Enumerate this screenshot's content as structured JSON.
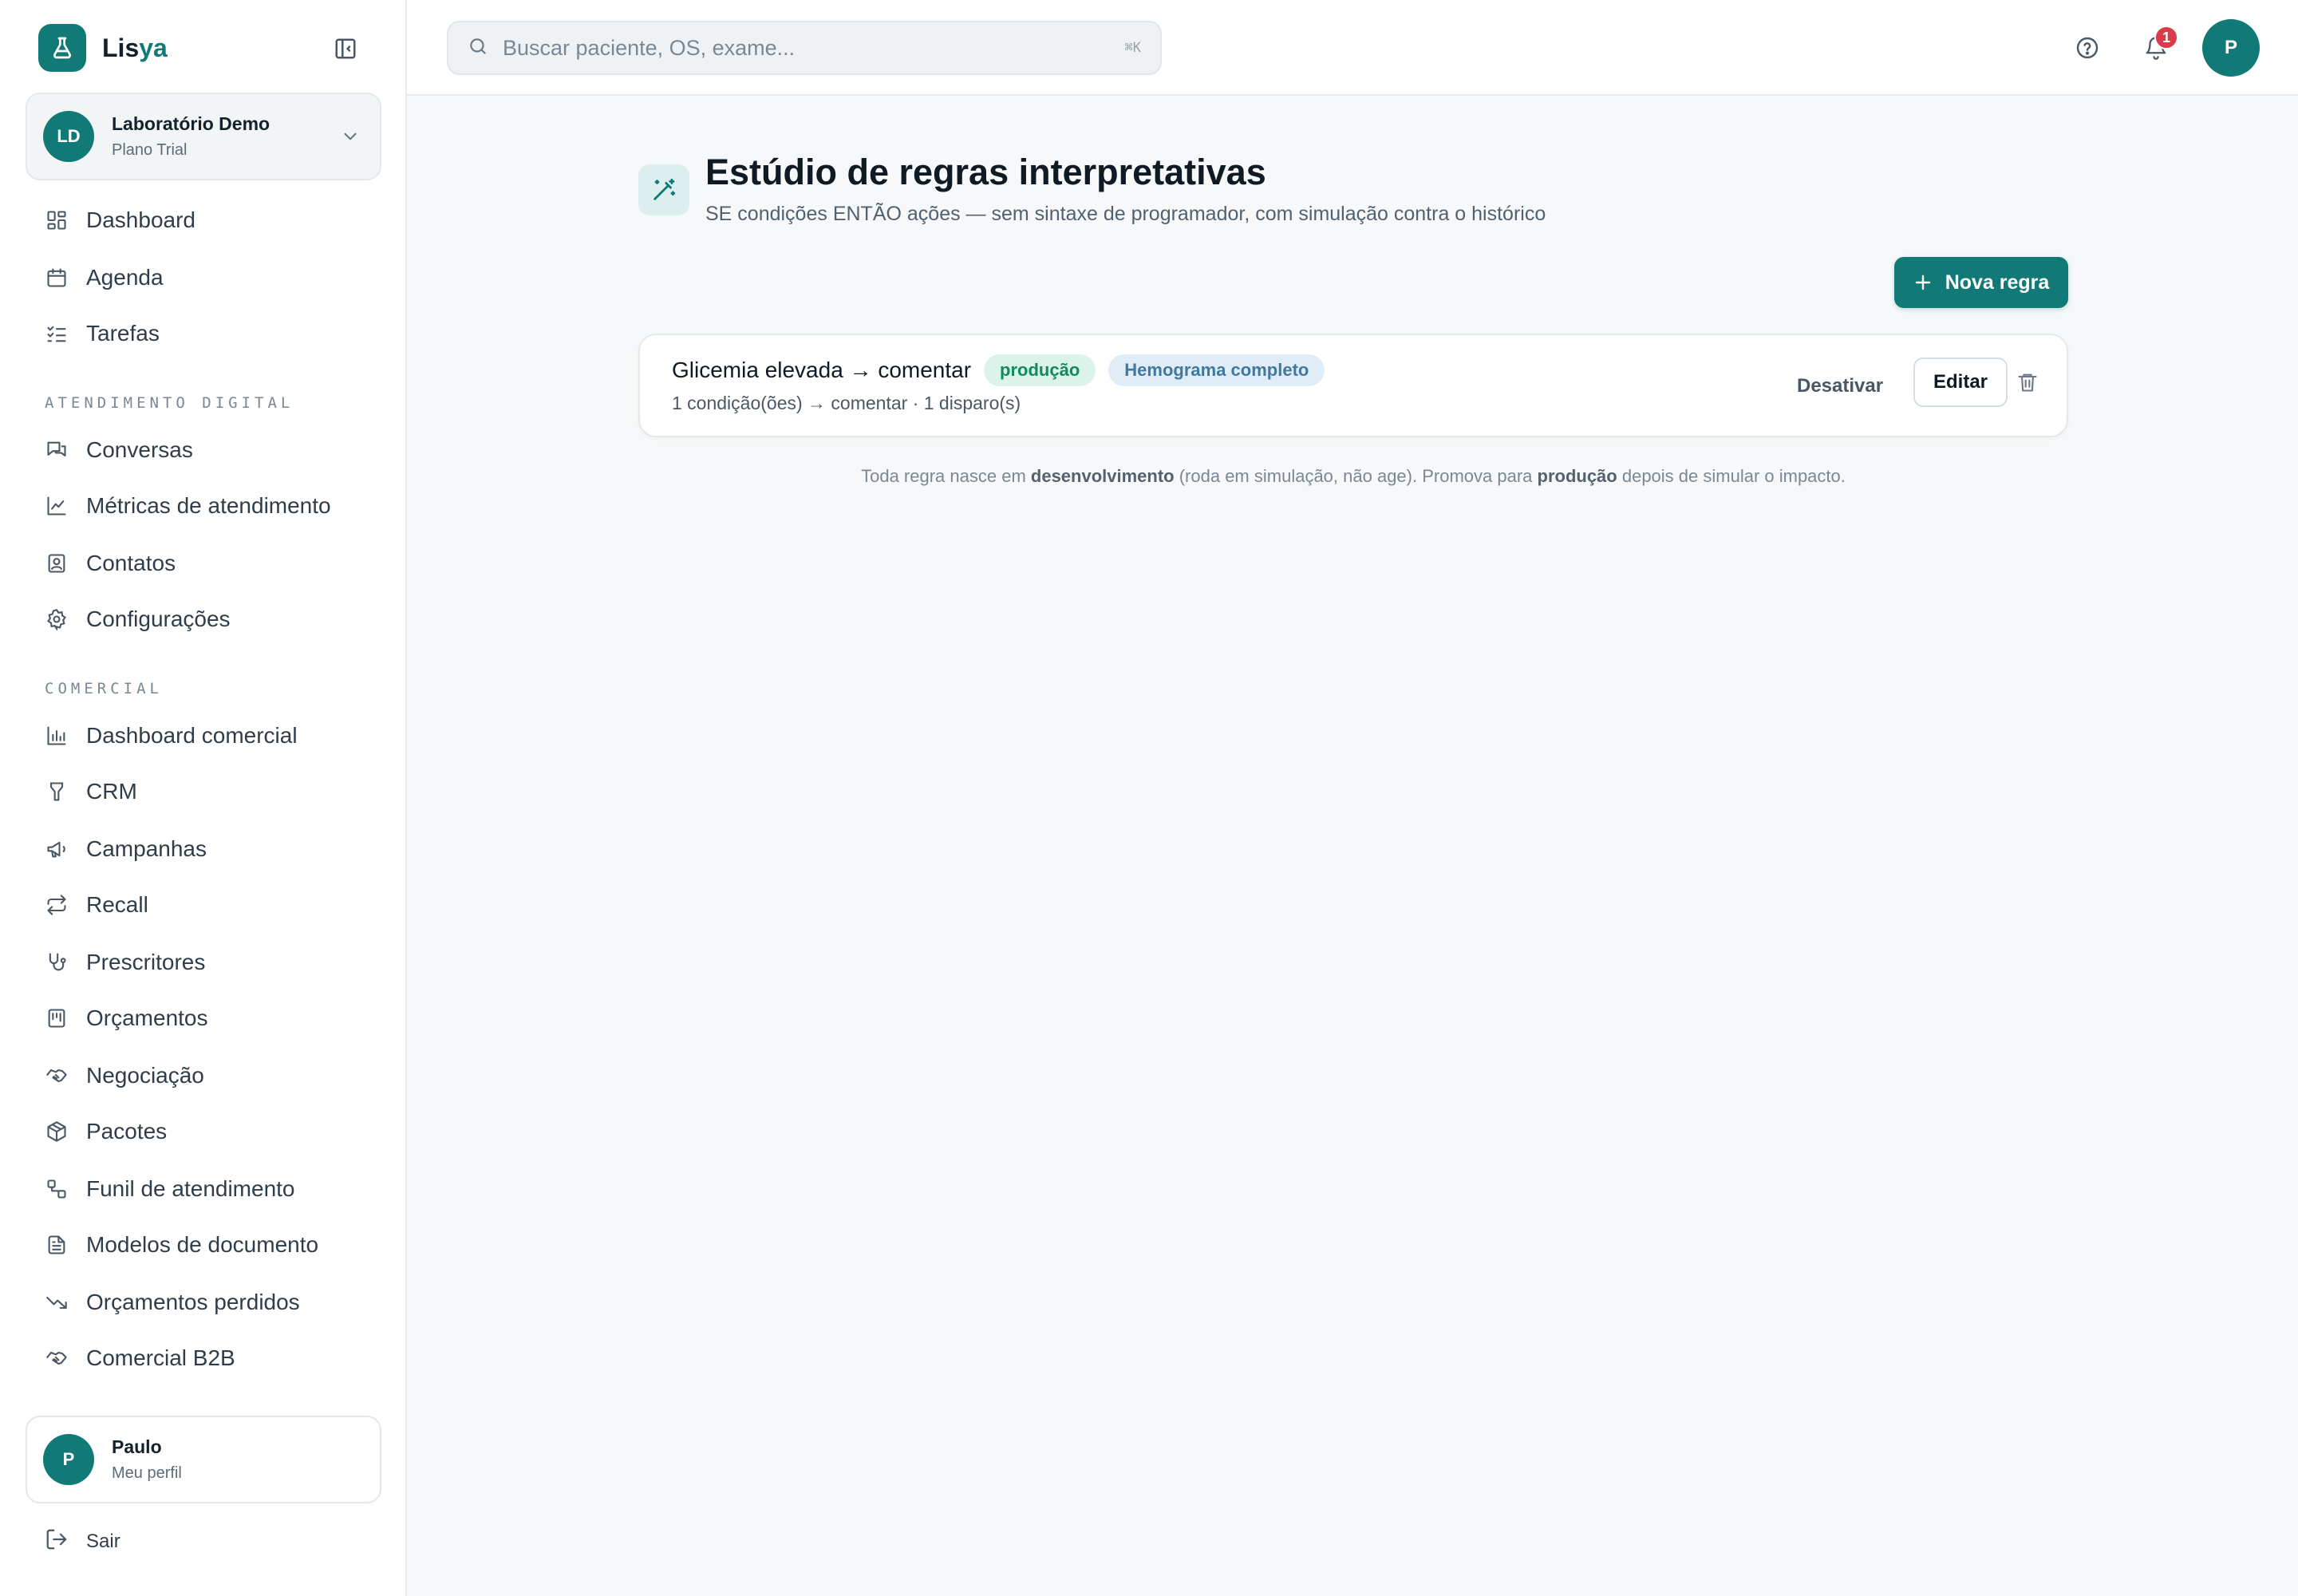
{
  "brand": {
    "prefix": "Lis",
    "accent": "ya",
    "color": "#127a76"
  },
  "org": {
    "initials": "LD",
    "name": "Laboratório Demo",
    "plan": "Plano Trial"
  },
  "nav": {
    "main": [
      {
        "label": "Dashboard",
        "icon": "layout-grid-icon"
      },
      {
        "label": "Agenda",
        "icon": "calendar-icon"
      },
      {
        "label": "Tarefas",
        "icon": "list-checks-icon"
      }
    ],
    "atendimento_title": "ATENDIMENTO DIGITAL",
    "atendimento": [
      {
        "label": "Conversas",
        "icon": "messages-icon"
      },
      {
        "label": "Métricas de atendimento",
        "icon": "line-chart-icon"
      },
      {
        "label": "Contatos",
        "icon": "contact-icon"
      },
      {
        "label": "Configurações",
        "icon": "gear-icon"
      }
    ],
    "comercial_title": "COMERCIAL",
    "comercial": [
      {
        "label": "Dashboard comercial",
        "icon": "bar-chart-icon"
      },
      {
        "label": "CRM",
        "icon": "funnel-icon"
      },
      {
        "label": "Campanhas",
        "icon": "megaphone-icon"
      },
      {
        "label": "Recall",
        "icon": "repeat-icon"
      },
      {
        "label": "Prescritores",
        "icon": "stethoscope-icon"
      },
      {
        "label": "Orçamentos",
        "icon": "receipt-icon"
      },
      {
        "label": "Negociação",
        "icon": "handshake-icon"
      },
      {
        "label": "Pacotes",
        "icon": "package-icon"
      },
      {
        "label": "Funil de atendimento",
        "icon": "workflow-icon"
      },
      {
        "label": "Modelos de documento",
        "icon": "file-text-icon"
      },
      {
        "label": "Orçamentos perdidos",
        "icon": "trending-down-icon"
      },
      {
        "label": "Comercial B2B",
        "icon": "handshake-icon"
      }
    ]
  },
  "profile": {
    "initial": "P",
    "name": "Paulo",
    "sub": "Meu perfil"
  },
  "logout_label": "Sair",
  "topbar": {
    "search_placeholder": "Buscar paciente, OS, exame...",
    "search_shortcut": "⌘K",
    "notification_count": "1",
    "user_initial": "P"
  },
  "page": {
    "title": "Estúdio de regras interpretativas",
    "subtitle": "SE condições ENTÃO ações — sem sintaxe de programador, com simulação contra o histórico",
    "new_rule_label": "Nova regra"
  },
  "rules": [
    {
      "name": "Glicemia elevada → comentar",
      "status": "produção",
      "exam": "Hemograma completo",
      "meta": "1 condição(ões) → comentar · 1 disparo(s)",
      "deactivate_label": "Desativar",
      "edit_label": "Editar"
    }
  ],
  "footnote": {
    "t1": "Toda regra nasce em ",
    "b1": "desenvolvimento",
    "t2": " (roda em simulação, não age). Promova para ",
    "b2": "produção",
    "t3": " depois de simular o impacto."
  },
  "colors": {
    "accent": "#127a76",
    "badge": "#d93b4a",
    "status_production_bg": "#dcf3ea",
    "status_production_fg": "#138a5a",
    "exam_pill_bg": "#e1edf6",
    "exam_pill_fg": "#41789e"
  }
}
